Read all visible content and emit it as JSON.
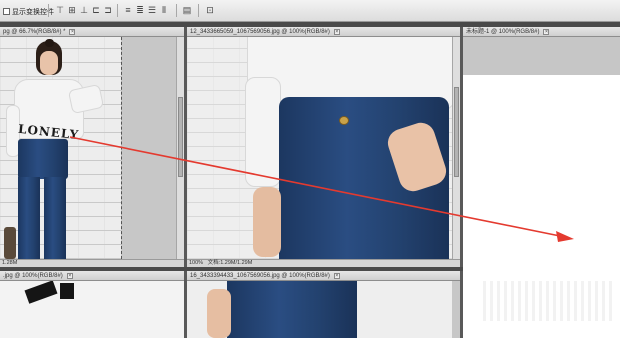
{
  "app": "Photoshop",
  "options_bar": {
    "show_transform_controls_label": "显示变换控件"
  },
  "docs": [
    {
      "tab": "pg @ 66.7%(RGB/8#) *",
      "status_zoom": "",
      "status_text": "1.28M",
      "photo_text": "LONELY"
    },
    {
      "tab": "12_3433665059_1067569056.jpg @ 100%(RGB/8#)",
      "status_zoom": "100%",
      "status_text": "文档:1.29M/1.29M"
    },
    {
      "tab": "未标题-1 @ 100%(RGB/8#)",
      "status_zoom": "",
      "status_text": ""
    },
    {
      "tab": ".jpg @ 100%(RGB/8#)",
      "status_zoom": "",
      "status_text": ""
    },
    {
      "tab": "16_3433394433_1067569056.jpg @ 100%(RGB/8#)",
      "status_zoom": "",
      "status_text": ""
    }
  ],
  "arrow_color": "#e43a2f"
}
